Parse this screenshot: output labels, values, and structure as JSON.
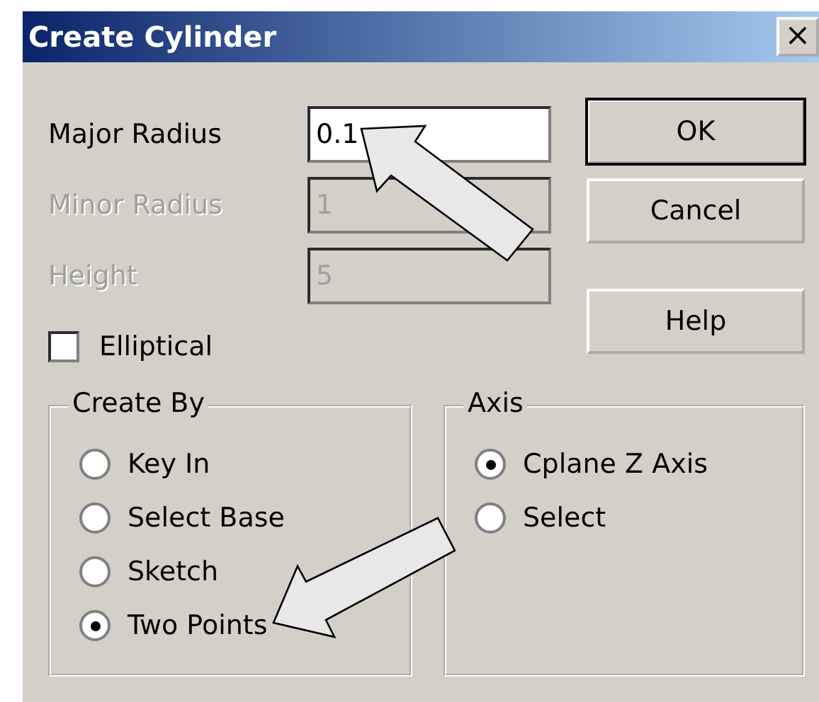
{
  "window": {
    "title": "Create Cylinder",
    "close": "×"
  },
  "fields": [
    {
      "label": "Major Radius",
      "value": "0.1",
      "disabled": false
    },
    {
      "label": "Minor Radius",
      "value": "1",
      "disabled": true
    },
    {
      "label": "Height",
      "value": "5",
      "disabled": true
    }
  ],
  "elliptical": {
    "label": "Elliptical",
    "checked": false
  },
  "buttons": [
    {
      "label": "OK",
      "default": true
    },
    {
      "label": "Cancel",
      "default": false
    },
    {
      "label": "Help",
      "default": false
    }
  ],
  "groups": [
    {
      "title": "Create By",
      "options": [
        {
          "label": "Key In",
          "selected": false
        },
        {
          "label": "Select Base",
          "selected": false
        },
        {
          "label": "Sketch",
          "selected": false
        },
        {
          "label": "Two Points",
          "selected": true
        }
      ]
    },
    {
      "title": "Axis",
      "options": [
        {
          "label": "Cplane Z Axis",
          "selected": true
        },
        {
          "label": "Select",
          "selected": false
        }
      ]
    }
  ]
}
